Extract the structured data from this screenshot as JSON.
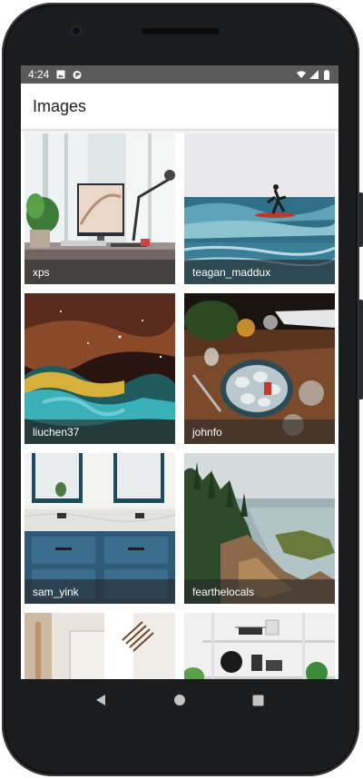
{
  "status_bar": {
    "time": "4:24",
    "icons": [
      "image-notification-icon",
      "app-notification-icon",
      "wifi-icon",
      "signal-icon",
      "battery-icon"
    ]
  },
  "app_bar": {
    "title": "Images"
  },
  "images": [
    {
      "author": "xps"
    },
    {
      "author": "teagan_maddux"
    },
    {
      "author": "liuchen37"
    },
    {
      "author": "johnfo"
    },
    {
      "author": "sam_yink"
    },
    {
      "author": "fearthelocals"
    },
    {
      "author": ""
    },
    {
      "author": ""
    }
  ],
  "nav_bar": {
    "buttons": [
      "back-icon",
      "home-icon",
      "recents-icon"
    ]
  },
  "colors": {
    "status_bar": "#5a5a5a",
    "caption_overlay": "#282828",
    "phone_frame": "#1b1c1e"
  }
}
